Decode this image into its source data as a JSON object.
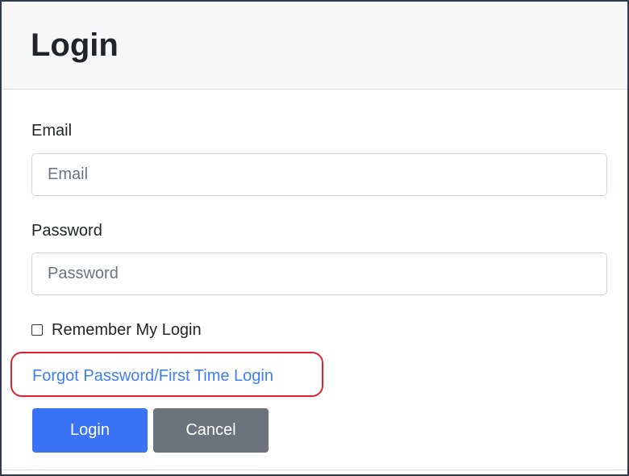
{
  "header": {
    "title": "Login"
  },
  "form": {
    "email": {
      "label": "Email",
      "placeholder": "Email",
      "value": ""
    },
    "password": {
      "label": "Password",
      "placeholder": "Password",
      "value": ""
    },
    "remember": {
      "label": "Remember My Login",
      "checked": false
    },
    "forgot_link": "Forgot Password/First Time Login",
    "login_button": "Login",
    "cancel_button": "Cancel"
  },
  "colors": {
    "primary": "#3b73f6",
    "secondary": "#6c737c",
    "link": "#3f7ef2",
    "highlight": "#e0202e",
    "header_bg": "#f7f7f7"
  }
}
